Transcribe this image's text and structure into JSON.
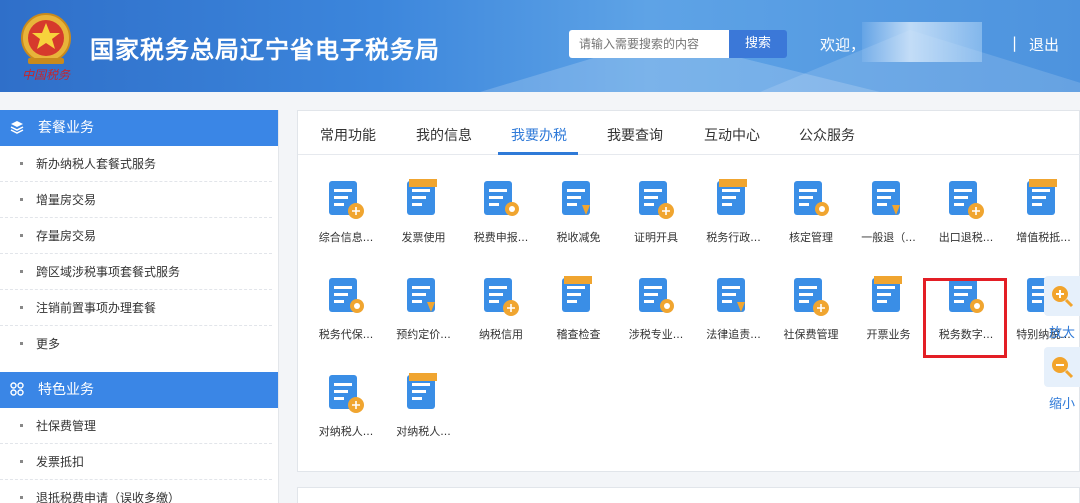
{
  "header": {
    "title": "国家税务总局辽宁省电子税务局",
    "signature": "中国税务",
    "search_placeholder": "请输入需要搜索的内容",
    "search_button": "搜索",
    "welcome": "欢迎，",
    "separator": "|",
    "logout": "退出"
  },
  "sidebar": {
    "sections": [
      {
        "title": "套餐业务",
        "icon": "layers-icon",
        "items": [
          "新办纳税人套餐式服务",
          "增量房交易",
          "存量房交易",
          "跨区域涉税事项套餐式服务",
          "注销前置事项办理套餐",
          "更多"
        ]
      },
      {
        "title": "特色业务",
        "icon": "grid-icon",
        "items": [
          "社保费管理",
          "发票抵扣",
          "退抵税费申请（误收多缴）"
        ]
      }
    ]
  },
  "tabs": [
    "常用功能",
    "我的信息",
    "我要办税",
    "我要查询",
    "互动中心",
    "公众服务"
  ],
  "active_tab": "我要办税",
  "tiles": [
    {
      "label": "综合信息...",
      "icon": "info-report-icon"
    },
    {
      "label": "发票使用",
      "icon": "invoice-icon"
    },
    {
      "label": "税费申报...",
      "icon": "tax-declare-icon"
    },
    {
      "label": "税收减免",
      "icon": "tax-relief-icon"
    },
    {
      "label": "证明开具",
      "icon": "certificate-icon"
    },
    {
      "label": "税务行政...",
      "icon": "admin-doc-icon"
    },
    {
      "label": "核定管理",
      "icon": "approval-icon"
    },
    {
      "label": "一般退（...",
      "icon": "refund-icon"
    },
    {
      "label": "出口退税...",
      "icon": "export-refund-icon"
    },
    {
      "label": "增值税抵...",
      "icon": "vat-credit-icon"
    },
    {
      "label": "税务代保...",
      "icon": "coin-stack-icon"
    },
    {
      "label": "预约定价...",
      "icon": "calendar-check-icon"
    },
    {
      "label": "纳税信用",
      "icon": "credit-shield-icon"
    },
    {
      "label": "稽查检查",
      "icon": "inspect-shield-icon"
    },
    {
      "label": "涉税专业...",
      "icon": "bank-doc-icon"
    },
    {
      "label": "法律追责...",
      "icon": "law-book-icon"
    },
    {
      "label": "社保费管理",
      "icon": "social-security-icon"
    },
    {
      "label": "开票业务",
      "icon": "issue-invoice-icon"
    },
    {
      "label": "税务数字...",
      "icon": "digital-account-icon"
    },
    {
      "label": "特别纳税...",
      "icon": "special-tax-icon"
    },
    {
      "label": "对纳税人...",
      "icon": "taxpayer-coin-icon"
    },
    {
      "label": "对纳税人...",
      "icon": "taxpayer-clock-icon"
    }
  ],
  "zoom": {
    "in_label": "放大",
    "out_label": "缩小"
  },
  "colors": {
    "header": "#3c86dc",
    "accent": "#2f7ad8",
    "highlight": "#e31e25",
    "tile_blue": "#3a8ee6",
    "tile_orange": "#f0a530"
  }
}
